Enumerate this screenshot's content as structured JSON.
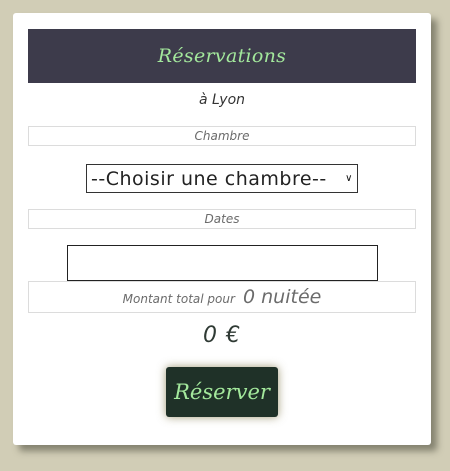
{
  "header": {
    "title": "Réservations"
  },
  "location": {
    "city": "à Lyon"
  },
  "room": {
    "section_label": "Chambre",
    "select_value": "--Choisir une chambre--"
  },
  "dates": {
    "section_label": "Dates",
    "input_value": ""
  },
  "total": {
    "label": "Montant total pour",
    "nights": "0 nuitée",
    "price": "0 €"
  },
  "actions": {
    "book_label": "Réserver"
  },
  "colors": {
    "page_bg": "#d1cdb6",
    "header_bg": "#3d3b4b",
    "accent_green": "#a3e89c",
    "button_bg": "#1f3128"
  },
  "icons": {
    "select_chevron": "chevron-down-icon"
  }
}
